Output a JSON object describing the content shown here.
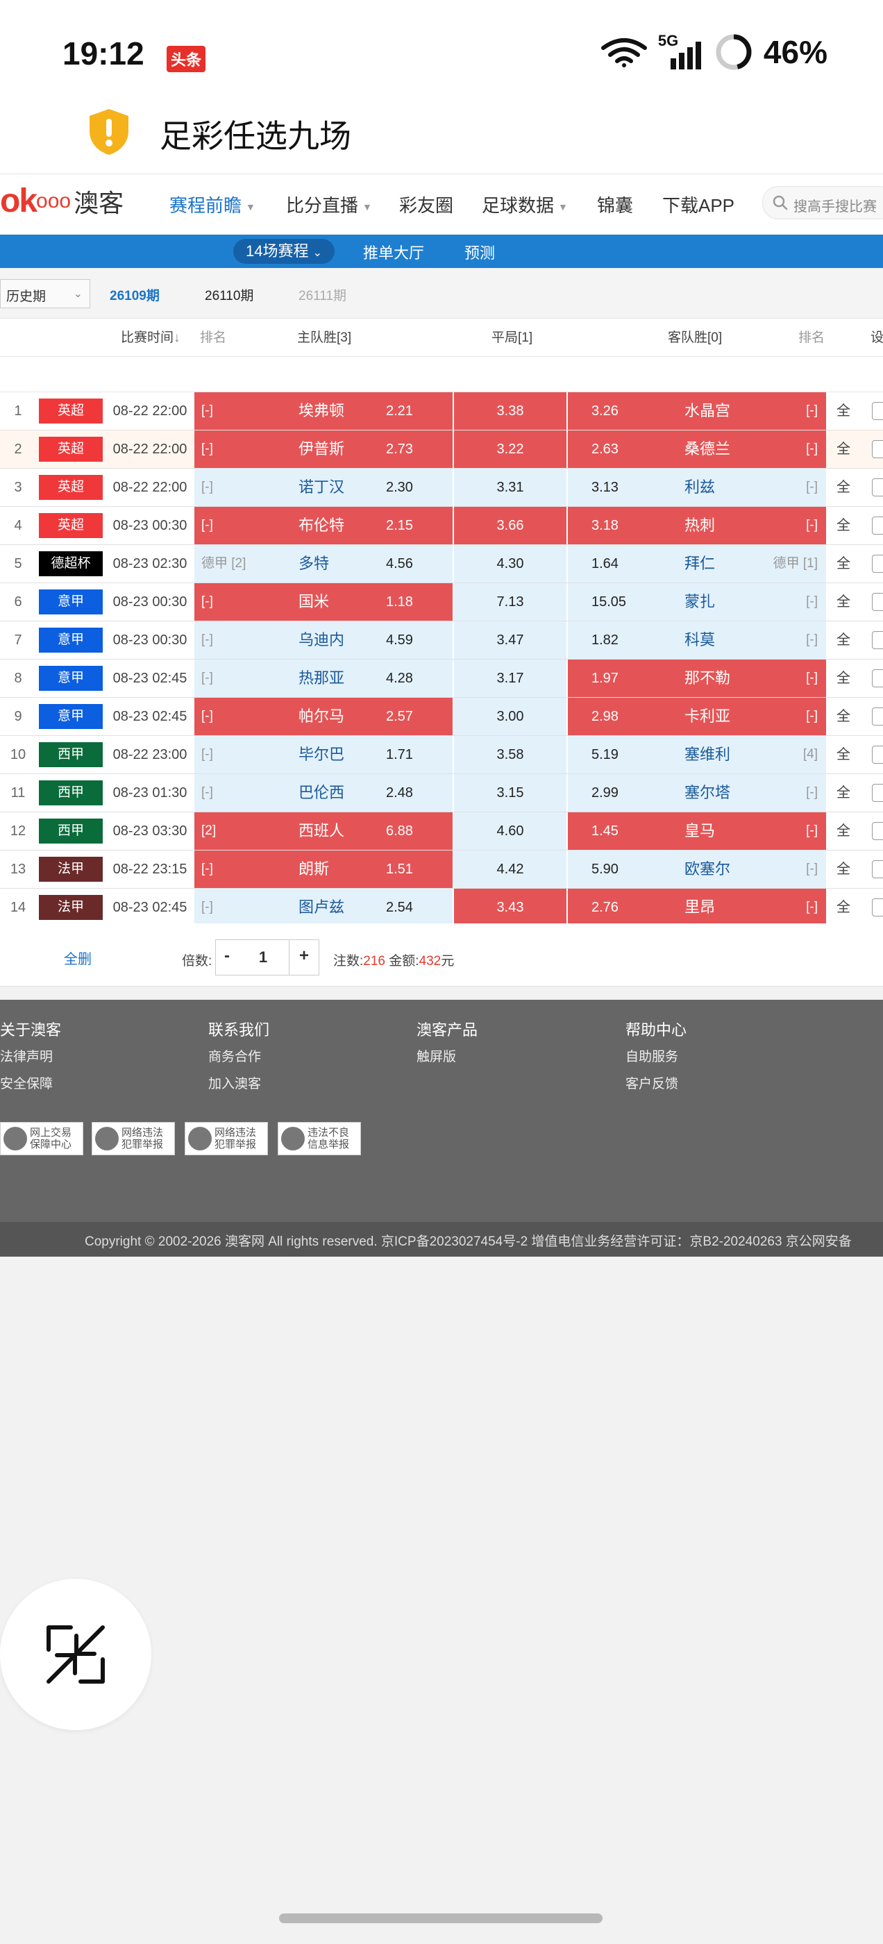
{
  "status_bar": {
    "time": "19:12",
    "badge": "头条",
    "network": "5G",
    "battery": "46%",
    "battery_level": 0.46
  },
  "title_bar": {
    "title": "足彩任选九场"
  },
  "site_nav": {
    "logo_text": "ok",
    "logo_ooo": "ooo",
    "logo_cn": "澳客",
    "items": [
      {
        "label": "赛程前瞻",
        "active": true,
        "dropdown": true
      },
      {
        "label": "比分直播",
        "active": false,
        "dropdown": true
      },
      {
        "label": "彩友圈",
        "active": false,
        "dropdown": false
      },
      {
        "label": "足球数据",
        "active": false,
        "dropdown": true
      },
      {
        "label": "锦囊",
        "active": false,
        "dropdown": false
      },
      {
        "label": "下载APP",
        "active": false,
        "dropdown": false
      }
    ],
    "search_placeholder": "搜高手搜比赛"
  },
  "sub_nav": {
    "tabs": [
      "14场赛程",
      "推单大厅",
      "预测"
    ]
  },
  "periods": {
    "history_label": "历史期",
    "items": [
      "26109期",
      "26110期",
      "26111期"
    ]
  },
  "table": {
    "headers": {
      "time": "比赛时间",
      "rank_home": "排名",
      "home": "主队胜[3]",
      "draw": "平局[1]",
      "away": "客队胜[0]",
      "rank_away": "排名",
      "settings": "设"
    },
    "all_label": "全",
    "rows": [
      {
        "no": "1",
        "league": "英超",
        "league_color": "#f0383b",
        "time": "08-22 22:00",
        "home_rank": "[-]",
        "home": "埃弗顿",
        "home_odds": "2.21",
        "draw_odds": "3.38",
        "away_odds": "3.26",
        "away": "水晶宫",
        "away_rank": "[-]",
        "hl": [
          "red",
          "red",
          "red"
        ]
      },
      {
        "no": "2",
        "league": "英超",
        "league_color": "#f0383b",
        "time": "08-22 22:00",
        "home_rank": "[-]",
        "home": "伊普斯",
        "home_odds": "2.73",
        "draw_odds": "3.22",
        "away_odds": "2.63",
        "away": "桑德兰",
        "away_rank": "[-]",
        "hl": [
          "red",
          "red",
          "red"
        ]
      },
      {
        "no": "3",
        "league": "英超",
        "league_color": "#f0383b",
        "time": "08-22 22:00",
        "home_rank": "[-]",
        "home": "诺丁汉",
        "home_odds": "2.30",
        "draw_odds": "3.31",
        "away_odds": "3.13",
        "away": "利兹",
        "away_rank": "[-]",
        "hl": [
          "blue",
          "blue",
          "blue"
        ]
      },
      {
        "no": "4",
        "league": "英超",
        "league_color": "#f0383b",
        "time": "08-23 00:30",
        "home_rank": "[-]",
        "home": "布伦特",
        "home_odds": "2.15",
        "draw_odds": "3.66",
        "away_odds": "3.18",
        "away": "热刺",
        "away_rank": "[-]",
        "hl": [
          "red",
          "red",
          "red"
        ]
      },
      {
        "no": "5",
        "league": "德超杯",
        "league_color": "#000000",
        "time": "08-23 02:30",
        "home_rank": "德甲 [2]",
        "home": "多特",
        "home_odds": "4.56",
        "draw_odds": "4.30",
        "away_odds": "1.64",
        "away": "拜仁",
        "away_rank": "德甲 [1]",
        "hl": [
          "blue",
          "blue",
          "blue"
        ]
      },
      {
        "no": "6",
        "league": "意甲",
        "league_color": "#0b5fe0",
        "time": "08-23 00:30",
        "home_rank": "[-]",
        "home": "国米",
        "home_odds": "1.18",
        "draw_odds": "7.13",
        "away_odds": "15.05",
        "away": "蒙扎",
        "away_rank": "[-]",
        "hl": [
          "red",
          "blue",
          "blue"
        ]
      },
      {
        "no": "7",
        "league": "意甲",
        "league_color": "#0b5fe0",
        "time": "08-23 00:30",
        "home_rank": "[-]",
        "home": "乌迪内",
        "home_odds": "4.59",
        "draw_odds": "3.47",
        "away_odds": "1.82",
        "away": "科莫",
        "away_rank": "[-]",
        "hl": [
          "blue",
          "blue",
          "blue"
        ]
      },
      {
        "no": "8",
        "league": "意甲",
        "league_color": "#0b5fe0",
        "time": "08-23 02:45",
        "home_rank": "[-]",
        "home": "热那亚",
        "home_odds": "4.28",
        "draw_odds": "3.17",
        "away_odds": "1.97",
        "away": "那不勒",
        "away_rank": "[-]",
        "hl": [
          "blue",
          "blue",
          "red"
        ]
      },
      {
        "no": "9",
        "league": "意甲",
        "league_color": "#0b5fe0",
        "time": "08-23 02:45",
        "home_rank": "[-]",
        "home": "帕尔马",
        "home_odds": "2.57",
        "draw_odds": "3.00",
        "away_odds": "2.98",
        "away": "卡利亚",
        "away_rank": "[-]",
        "hl": [
          "red",
          "blue",
          "red"
        ]
      },
      {
        "no": "10",
        "league": "西甲",
        "league_color": "#0a6b3b",
        "time": "08-22 23:00",
        "home_rank": "[-]",
        "home": "毕尔巴",
        "home_odds": "1.71",
        "draw_odds": "3.58",
        "away_odds": "5.19",
        "away": "塞维利",
        "away_rank": "[4]",
        "hl": [
          "blue",
          "blue",
          "blue"
        ]
      },
      {
        "no": "11",
        "league": "西甲",
        "league_color": "#0a6b3b",
        "time": "08-23 01:30",
        "home_rank": "[-]",
        "home": "巴伦西",
        "home_odds": "2.48",
        "draw_odds": "3.15",
        "away_odds": "2.99",
        "away": "塞尔塔",
        "away_rank": "[-]",
        "hl": [
          "blue",
          "blue",
          "blue"
        ]
      },
      {
        "no": "12",
        "league": "西甲",
        "league_color": "#0a6b3b",
        "time": "08-23 03:30",
        "home_rank": "[2]",
        "home": "西班人",
        "home_odds": "6.88",
        "draw_odds": "4.60",
        "away_odds": "1.45",
        "away": "皇马",
        "away_rank": "[-]",
        "hl": [
          "red",
          "blue",
          "red"
        ]
      },
      {
        "no": "13",
        "league": "法甲",
        "league_color": "#6b2a2a",
        "time": "08-22 23:15",
        "home_rank": "[-]",
        "home": "朗斯",
        "home_odds": "1.51",
        "draw_odds": "4.42",
        "away_odds": "5.90",
        "away": "欧塞尔",
        "away_rank": "[-]",
        "hl": [
          "red",
          "blue",
          "blue"
        ]
      },
      {
        "no": "14",
        "league": "法甲",
        "league_color": "#6b2a2a",
        "time": "08-23 02:45",
        "home_rank": "[-]",
        "home": "图卢兹",
        "home_odds": "2.54",
        "draw_odds": "3.43",
        "away_odds": "2.76",
        "away": "里昂",
        "away_rank": "[-]",
        "hl": [
          "blue",
          "red",
          "red"
        ]
      }
    ]
  },
  "controls": {
    "clear_label": "全删",
    "multiplier_label": "倍数:",
    "minus": "-",
    "plus": "+",
    "multiplier": "1",
    "bets_label": "注数:",
    "bets": "216",
    "amount_label": "金额:",
    "amount": "432",
    "currency": "元"
  },
  "footer": {
    "columns": [
      {
        "title": "关于澳客",
        "links": [
          "法律声明",
          "安全保障"
        ]
      },
      {
        "title": "联系我们",
        "links": [
          "商务合作",
          "加入澳客"
        ]
      },
      {
        "title": "澳客产品",
        "links": [
          "触屏版"
        ]
      },
      {
        "title": "帮助中心",
        "links": [
          "自助服务",
          "客户反馈"
        ]
      }
    ],
    "badges": [
      {
        "line1": "网上交易",
        "line2": "保障中心"
      },
      {
        "line1": "网络违法",
        "line2": "犯罪举报"
      },
      {
        "line1": "网络违法",
        "line2": "犯罪举报"
      },
      {
        "line1": "违法不良",
        "line2": "信息举报"
      }
    ],
    "copyright": "Copyright © 2002-2026 澳客网  All rights reserved.    京ICP备2023027454号-2   增值电信业务经营许可证：京B2-20240263   京公网安备"
  }
}
